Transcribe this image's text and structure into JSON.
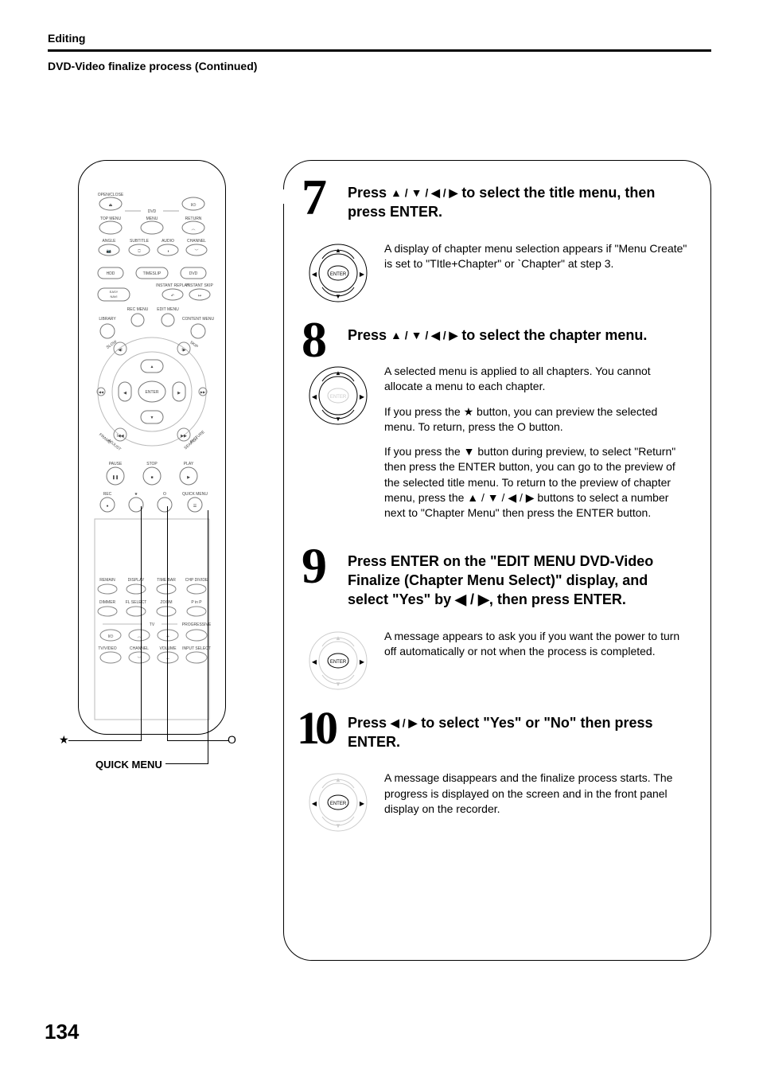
{
  "header": {
    "section": "Editing",
    "subsection": "DVD-Video finalize process (Continued)"
  },
  "remote": {
    "labels": {
      "open_close": "OPEN/CLOSE",
      "dvd_group": "DVD",
      "top_menu": "TOP MENU",
      "menu": "MENU",
      "return": "RETURN",
      "angle": "ANGLE",
      "subtitle": "SUBTITLE",
      "audio": "AUDIO",
      "channel": "CHANNEL",
      "hdd": "HDD",
      "timeslip": "TIMESLIP",
      "dvd": "DVD",
      "easy_navi": "EASY\nNAVI",
      "instant_replay": "INSTANT REPLAY",
      "instant_skip": "INSTANT SKIP",
      "rec_menu": "REC MENU",
      "edit_menu": "EDIT MENU",
      "library": "LIBRARY",
      "content_menu": "CONTENT MENU",
      "slow": "SLOW",
      "skip": "SKIP",
      "frame": "FRAME",
      "adjust": "ADJUST",
      "picture": "PICTURE",
      "search": "SEARCH",
      "enter": "ENTER",
      "pause": "PAUSE",
      "stop": "STOP",
      "play": "PLAY",
      "rec": "REC",
      "star": "★",
      "o": "O",
      "quick_menu": "QUICK MENU",
      "remain": "REMAIN",
      "display": "DISPLAY",
      "time_bar": "TIME BAR",
      "chp_divide": "CHP DIVIDE",
      "dimmer": "DIMMER",
      "fl_select": "FL SELECT",
      "zoom": "ZOOM",
      "p_in_p": "P in P",
      "tv": "TV",
      "progressive": "PROGRESSIVE",
      "tv_video": "TV/VIDEO",
      "channel_tv": "CHANNEL",
      "volume": "VOLUME",
      "input_select": "INPUT SELECT"
    },
    "callouts": {
      "star": "★",
      "o": "O",
      "quick_menu": "QUICK MENU"
    }
  },
  "steps": [
    {
      "num": "7",
      "title_pre": "Press ",
      "title_arrows": "▲ / ▼ / ◀ / ▶",
      "title_post": " to select the title menu, then press ENTER.",
      "dpad_enter": "ENTER",
      "paras": [
        "A display of chapter menu selection appears if \"Menu Create\" is set to \"TItle+Chapter\" or `Chapter\" at step 3."
      ]
    },
    {
      "num": "8",
      "title_pre": "Press ",
      "title_arrows": "▲ / ▼ / ◀ / ▶",
      "title_post": " to select the chapter menu.",
      "dpad_enter": "ENTER",
      "paras": [
        "A selected menu is applied to all chapters. You cannot allocate a menu to each chapter.",
        "If you press the ★ button, you can preview the selected menu. To return, press the O button.",
        "If you press the ▼ button during preview, to select \"Return\" then press the ENTER button, you can go to the preview of the selected title menu. To return to the preview of chapter menu, press the ▲ / ▼ / ◀ / ▶ buttons to select a number next to \"Chapter Menu\" then press the ENTER button."
      ]
    },
    {
      "num": "9",
      "title_full": "Press ENTER on the \"EDIT MENU DVD-Video Finalize (Chapter Menu Select)\" display, and select \"Yes\" by ◀ / ▶, then press ENTER.",
      "dpad_enter": "ENTER",
      "paras": [
        "A message appears to ask you if you want the power to turn off automatically or not when the process is completed."
      ]
    },
    {
      "num": "10",
      "title_pre": "Press ",
      "title_arrows": "◀ / ▶",
      "title_post": " to select \"Yes\" or \"No\" then press ENTER.",
      "dpad_enter": "ENTER",
      "paras": [
        "A message disappears and the finalize process starts. The progress is displayed on the screen and in the front panel display on the recorder."
      ]
    }
  ],
  "page_number": "134"
}
